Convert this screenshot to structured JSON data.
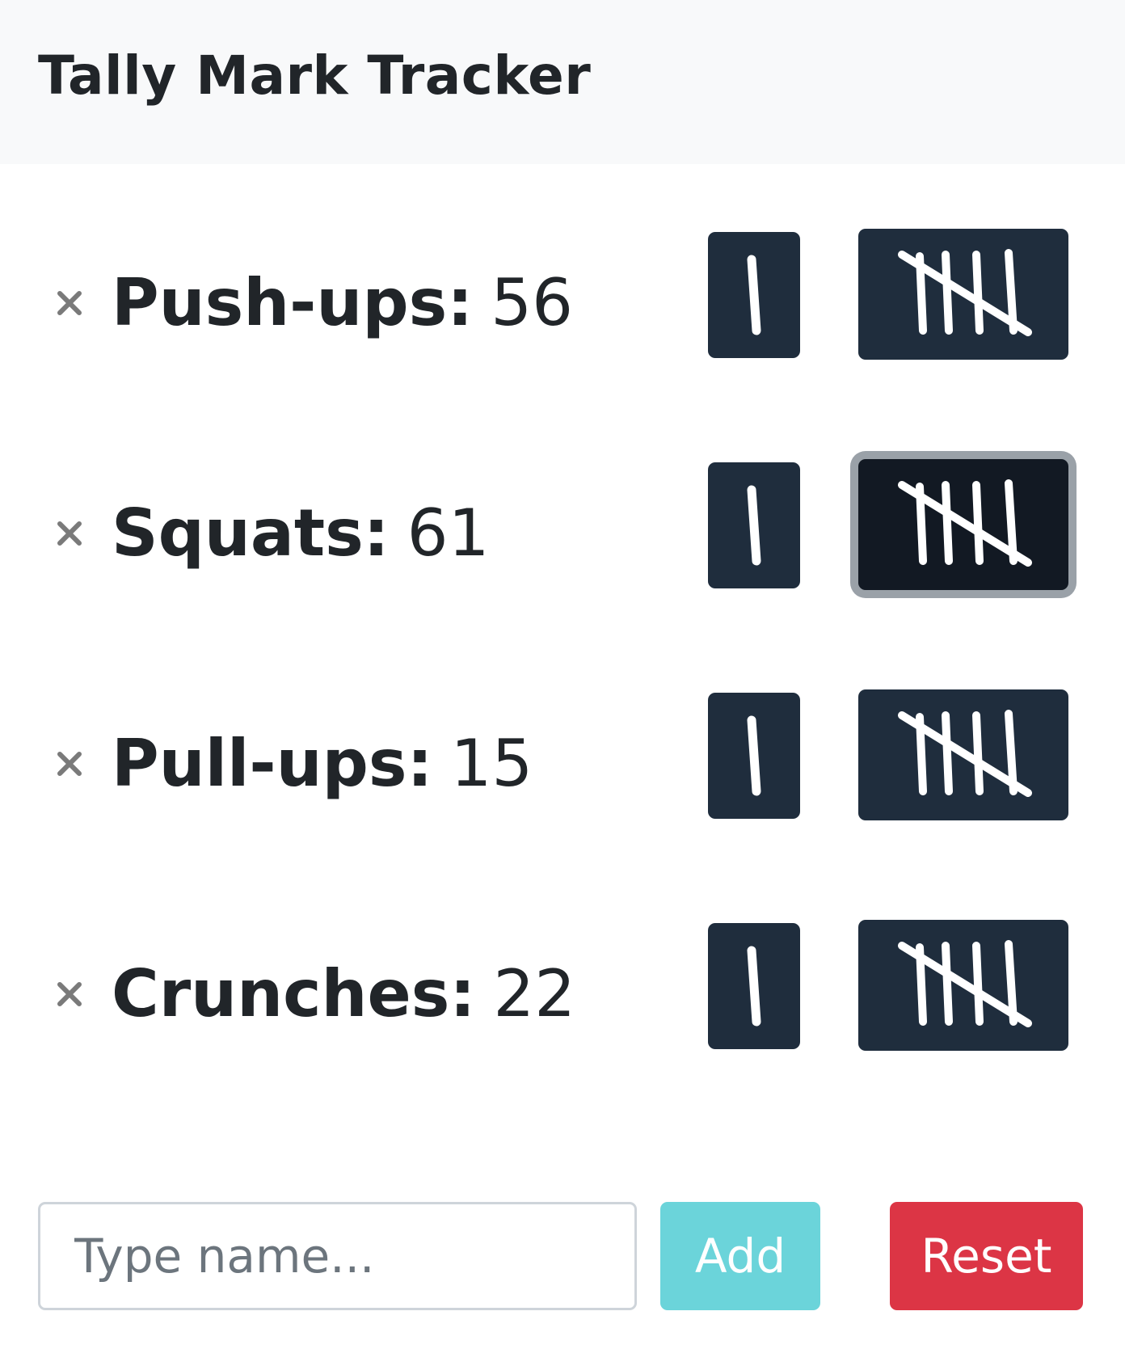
{
  "header": {
    "title": "Tally Mark Tracker"
  },
  "rows": [
    {
      "name": "Push-ups:",
      "count": "56",
      "remove_icon": "close-icon",
      "add_one_icon": "tally-one-icon",
      "add_five_icon": "tally-five-icon"
    },
    {
      "name": "Squats:",
      "count": "61",
      "remove_icon": "close-icon",
      "add_one_icon": "tally-one-icon",
      "add_five_icon": "tally-five-icon"
    },
    {
      "name": "Pull-ups:",
      "count": "15",
      "remove_icon": "close-icon",
      "add_one_icon": "tally-one-icon",
      "add_five_icon": "tally-five-icon"
    },
    {
      "name": "Crunches:",
      "count": "22",
      "remove_icon": "close-icon",
      "add_one_icon": "tally-one-icon",
      "add_five_icon": "tally-five-icon"
    }
  ],
  "footer": {
    "name_input_placeholder": "Type name...",
    "name_input_value": "",
    "add_label": "Add",
    "reset_label": "Reset"
  },
  "colors": {
    "header_bg": "#f8f9fa",
    "tally_button_bg": "#1f2d3d",
    "tally_button_focused_bg": "#121923",
    "add_button_bg": "#6bd4da",
    "reset_button_bg": "#dc3545"
  }
}
